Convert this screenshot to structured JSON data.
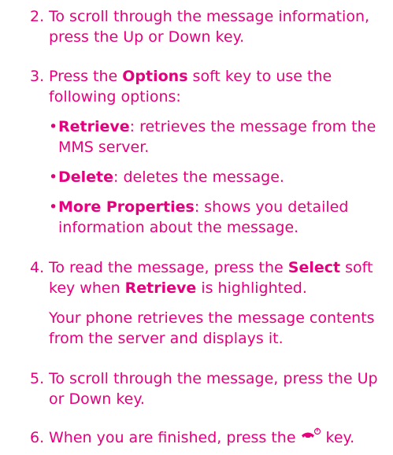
{
  "steps": [
    {
      "number": "2.",
      "line1": "To scroll through the message information,",
      "line2": "press the Up or Down key."
    },
    {
      "number": "3.",
      "text_before": "Press the ",
      "bold": "Options",
      "text_after": " soft key to use the",
      "line2": "following options:"
    },
    {
      "number": "4.",
      "text_before": "To read the message, press the ",
      "bold1": "Select",
      "text_mid": " soft",
      "line2_before": "key when ",
      "bold2": "Retrieve",
      "line2_after": " is highlighted."
    },
    {
      "number": "5.",
      "line1": "To scroll through the message, press the Up",
      "line2": "or Down key."
    },
    {
      "number": "6.",
      "text_before": "When you are finished, press the",
      "text_after": "key."
    }
  ],
  "options": [
    {
      "bullet": "•",
      "label": "Retrieve",
      "desc_line1": ": retrieves the message from the",
      "desc_line2": "MMS server."
    },
    {
      "bullet": "•",
      "label": "Delete",
      "desc_line1": ": deletes the message."
    },
    {
      "bullet": "•",
      "label": "More Properties",
      "desc_line1": ": shows you detailed",
      "desc_line2": "information about the message."
    }
  ],
  "step4_note": {
    "line1": "Your phone retrieves the message contents",
    "line2": "from the server and displays it."
  },
  "colors": {
    "text": "#e5007e"
  },
  "icons": {
    "end_key": "end-call-power-key-icon"
  }
}
